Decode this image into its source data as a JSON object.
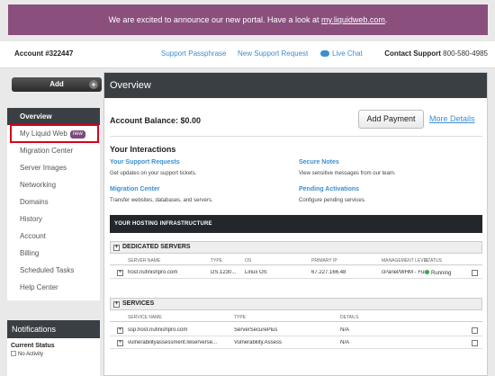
{
  "banner": {
    "text": "We are excited to announce our new portal. Have a look at ",
    "link": "my.liquidweb.com",
    "end": "."
  },
  "header": {
    "account": "Account #322447",
    "support_passphrase": "Support Passphrase",
    "new_support_request": "New Support Request",
    "live_chat": "Live Chat",
    "contact_label": "Contact Support",
    "contact_phone": "800-580-4985"
  },
  "sidebar": {
    "add_label": "Add",
    "add_plus": "+",
    "items": [
      "Overview",
      "My Liquid Web",
      "Migration Center",
      "Server Images",
      "Networking",
      "Domains",
      "History",
      "Account",
      "Billing",
      "Scheduled Tasks",
      "Help Center"
    ],
    "new_badge": "new"
  },
  "notifications": {
    "title": "Notifications",
    "current_status": "Current Status",
    "no_activity": "No Activity"
  },
  "main": {
    "title": "Overview",
    "balance": "Account Balance: $0.00",
    "add_payment": "Add Payment",
    "more_details": "More Details",
    "interactions_title": "Your Interactions",
    "interactions": [
      {
        "link": "Your Support Requests",
        "desc": "Get updates on your support tickets."
      },
      {
        "link": "Secure Notes",
        "desc": "View sensitive messages from our team."
      },
      {
        "link": "Migration Center",
        "desc": "Transfer websites, databases, and servers."
      },
      {
        "link": "Pending Activations",
        "desc": "Configure pending services."
      }
    ],
    "hosting_title": "YOUR HOSTING INFRASTRUCTURE",
    "dedicated": {
      "title": "DEDICATED SERVERS",
      "columns": [
        "SERVER NAME",
        "TYPE",
        "OS",
        "PRIMARY IP",
        "MANAGEMENT LEVEL",
        "STATUS"
      ],
      "rows": [
        {
          "name": "host.nufinishpro.com",
          "type": "DS.1230...",
          "os": "Linux OS",
          "ip": "67.227.166.48",
          "mgmt": "cPanel/WHM - Fully ...",
          "status": "Running"
        }
      ]
    },
    "services": {
      "title": "SERVICES",
      "columns": [
        "SERVICE NAME",
        "TYPE",
        "DETAILS"
      ],
      "rows": [
        {
          "name": "ssp.host.nufinishpro.com",
          "type": "ServerSecurePlus",
          "details": "N/A"
        },
        {
          "name": "vulnerabilityassessment.lwserverse...",
          "type": "Vulnerability.Assess",
          "details": "N/A"
        }
      ]
    }
  },
  "colors": {
    "banner": "#8a4f7d",
    "dark": "#3a3f44",
    "link": "#3b8fd0",
    "highlight": "#d9001b",
    "running": "#3aa847"
  }
}
